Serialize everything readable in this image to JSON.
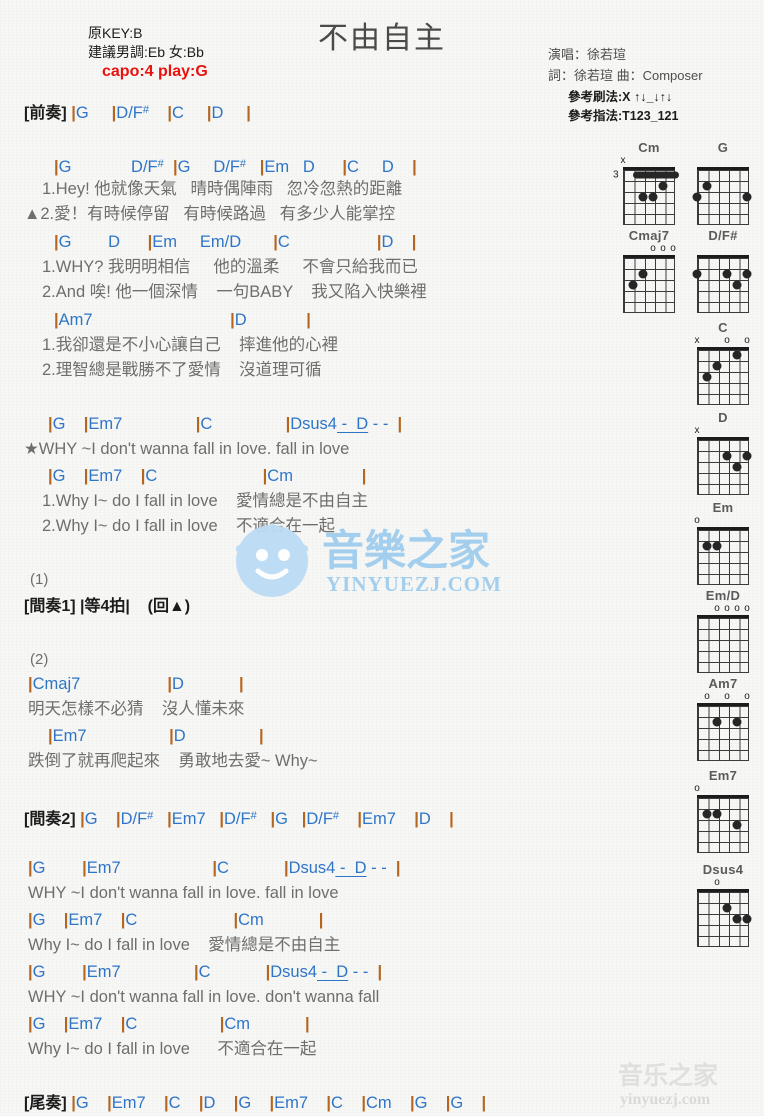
{
  "song": {
    "title": "不由自主",
    "original_key_label": "原KEY:B",
    "suggested_key_label": "建議男調:Eb 女:Bb",
    "capo_label": "capo:4 play:G",
    "singer_label": "演唱：徐若瑄",
    "writer_label": "詞：徐若瑄  曲：Composer",
    "strum_label": "參考刷法:X ↑↓_↓↑↓",
    "fingerstyle_label": "參考指法:T123_121",
    "accent_color": "#e8130f",
    "chord_color": "#2e75c8",
    "lyric_color": "#6e6e6e",
    "bar_color": "#b5651d"
  },
  "sections": [
    {
      "tag": "[前奏]",
      "chords": "|G    |D/F#    |C    |D    |"
    }
  ],
  "lines": {
    "intro_tag": "[前奏]",
    "intro_chords": "|G      |D/F#      |C      |D      |",
    "v1_chord1": "|G            D/F#   |G     D/F#    |Em    D       |C      D     |",
    "v1_lyric1": "1.Hey! 他就像天氣   晴時偶陣雨   忽冷忽熱的距離",
    "v1_lyric2": "▲2.愛！有時候停留   有時候路過   有多少人能掌控",
    "v1_chord2": "|G        D      |Em      Em/D       |C                    |D    |",
    "v1_lyric3": "1.WHY? 我明明相信     他的溫柔     不會只給我而已",
    "v1_lyric4": "2.And 唉! 他一個深情    一句BABY    我又陷入快樂裡",
    "v1_chord3": "|Am7                          |D             |",
    "v1_lyric5": "1.我卻還是不小心讓自己    摔進他的心裡",
    "v1_lyric6": "2.理智總是戰勝不了愛情    沒道理可循",
    "ch_chord1": "|G    |Em7                |C                |Dsus4  -  D  -  -  |",
    "ch_lyric1": "★WHY ~I don't wanna fall in love. fall in love",
    "ch_chord2": "|G    |Em7    |C                        |Cm               |",
    "ch_lyric2": "1.Why I~ do I fall in love    愛情總是不由自主",
    "ch_lyric3": "2.Why I~ do I fall in love    不適合在一起",
    "num1": "(1)",
    "interlude1": "[間奏1] |等4拍|    (回▲)",
    "num2": "(2)",
    "b_chord1": "|Cmaj7                    |D             |",
    "b_lyric1": "明天怎樣不必猜    沒人懂未來",
    "b_chord2": "|Em7                     |D                 |",
    "b_lyric2": "跌倒了就再爬起來    勇敢地去愛~ Why~",
    "interlude2_tag": "[間奏2]",
    "interlude2_chords": "|G     |D/F#    |Em7    |D/F#    |G    |D/F#     |Em7     |D      |",
    "ch2_chord1": "|G        |Em7                    |C            |Dsus4  -  D  -  -  |",
    "ch2_lyric1": "WHY ~I don't wanna fall in love. fall in love",
    "ch2_chord2": "|G    |Em7    |C                      |Cm            |",
    "ch2_lyric2": "Why I~ do I fall in love    愛情總是不由自主",
    "ch2_chord3": "|G        |Em7                |C            |Dsus4  -  D  -  -  |",
    "ch2_lyric3": "WHY ~I don't wanna fall in love. don't wanna fall",
    "ch2_chord4": "|G    |Em7    |C                    |Cm            |",
    "ch2_lyric4": "Why I~ do I fall in love      不適合在一起",
    "outro_tag": "[尾奏]",
    "outro_chords": "|G    |Em7    |C    |D    |G    |Em7    |C    |Cm    |G    |G     |"
  },
  "diagrams": [
    {
      "name": "Cm",
      "markers": [
        {
          "label": "x",
          "string": 6
        }
      ],
      "fret_label": "3",
      "barre": {
        "from": 5,
        "to": 1,
        "fret": 1
      },
      "dots": [
        {
          "string": 2,
          "fret": 2
        },
        {
          "string": 4,
          "fret": 3
        },
        {
          "string": 3,
          "fret": 3
        }
      ]
    },
    {
      "name": "G",
      "markers": [],
      "fret_label": "",
      "dots": [
        {
          "string": 5,
          "fret": 2
        },
        {
          "string": 6,
          "fret": 3
        },
        {
          "string": 1,
          "fret": 3
        }
      ]
    },
    {
      "name": "Cmaj7",
      "markers": [
        {
          "label": "o",
          "string": 3
        },
        {
          "label": "o",
          "string": 2
        },
        {
          "label": "o",
          "string": 1
        }
      ],
      "fret_label": "",
      "dots": [
        {
          "string": 4,
          "fret": 2
        },
        {
          "string": 5,
          "fret": 3
        }
      ]
    },
    {
      "name": "D/F#",
      "markers": [],
      "fret_label": "",
      "dots": [
        {
          "string": 6,
          "fret": 2
        },
        {
          "string": 3,
          "fret": 2
        },
        {
          "string": 1,
          "fret": 2
        },
        {
          "string": 2,
          "fret": 3
        }
      ]
    },
    {
      "name": "C",
      "markers": [
        {
          "label": "x",
          "string": 6
        },
        {
          "label": "o",
          "string": 3
        },
        {
          "label": "o",
          "string": 1
        }
      ],
      "fret_label": "",
      "dots": [
        {
          "string": 2,
          "fret": 1
        },
        {
          "string": 4,
          "fret": 2
        },
        {
          "string": 5,
          "fret": 3
        }
      ]
    },
    {
      "name": "D",
      "markers": [
        {
          "label": "x",
          "string": 6
        }
      ],
      "fret_label": "",
      "dots": [
        {
          "string": 3,
          "fret": 2
        },
        {
          "string": 1,
          "fret": 2
        },
        {
          "string": 2,
          "fret": 3
        }
      ]
    },
    {
      "name": "Em",
      "markers": [
        {
          "label": "o",
          "string": 6
        }
      ],
      "fret_label": "",
      "dots": [
        {
          "string": 5,
          "fret": 2
        },
        {
          "string": 4,
          "fret": 2
        }
      ]
    },
    {
      "name": "Em/D",
      "markers": [
        {
          "label": "o",
          "string": 4
        },
        {
          "label": "o",
          "string": 3
        },
        {
          "label": "o",
          "string": 2
        },
        {
          "label": "o",
          "string": 1
        }
      ],
      "fret_label": "",
      "dots": []
    },
    {
      "name": "Am7",
      "markers": [
        {
          "label": "o",
          "string": 5
        },
        {
          "label": "o",
          "string": 3
        },
        {
          "label": "o",
          "string": 1
        }
      ],
      "fret_label": "",
      "dots": [
        {
          "string": 4,
          "fret": 2
        },
        {
          "string": 2,
          "fret": 2
        }
      ]
    },
    {
      "name": "Em7",
      "markers": [
        {
          "label": "o",
          "string": 6
        }
      ],
      "fret_label": "",
      "dots": [
        {
          "string": 5,
          "fret": 2
        },
        {
          "string": 4,
          "fret": 2
        },
        {
          "string": 2,
          "fret": 3
        }
      ]
    },
    {
      "name": "Dsus4",
      "markers": [
        {
          "label": "o",
          "string": 4
        }
      ],
      "fret_label": "",
      "dots": [
        {
          "string": 3,
          "fret": 2
        },
        {
          "string": 2,
          "fret": 3
        },
        {
          "string": 1,
          "fret": 3
        }
      ]
    }
  ],
  "watermark": {
    "center_cn": "音樂之家",
    "center_url": "YINYUEZJ.COM",
    "bottom_cn": "音乐之家",
    "bottom_url": "yinyuezj.com"
  }
}
